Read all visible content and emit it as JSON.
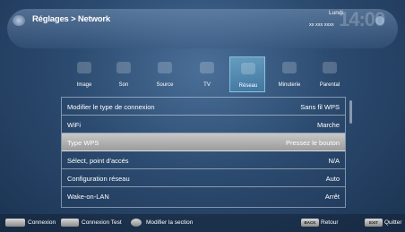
{
  "header": {
    "breadcrumb": "Réglages > Network",
    "day": "Lundi",
    "date": "xx xxx xxxx",
    "clock": "14:00"
  },
  "tabs": [
    {
      "label": "Image",
      "icon": "image-icon",
      "active": false
    },
    {
      "label": "Son",
      "icon": "sound-icon",
      "active": false
    },
    {
      "label": "Source",
      "icon": "source-icon",
      "active": false
    },
    {
      "label": "TV",
      "icon": "tv-icon",
      "active": false
    },
    {
      "label": "Réseau",
      "icon": "network-icon",
      "active": true
    },
    {
      "label": "Minuterie",
      "icon": "timer-icon",
      "active": false
    },
    {
      "label": "Parental",
      "icon": "parental-icon",
      "active": false
    }
  ],
  "rows": [
    {
      "label": "Modifier le type de connexion",
      "value": "Sans fil WPS",
      "selected": false
    },
    {
      "label": "WiFi",
      "value": "Marche",
      "selected": false
    },
    {
      "label": "Type WPS",
      "value": "Pressez le bouton",
      "selected": true
    },
    {
      "label": "Sélect, point d'accés",
      "value": "N/A",
      "selected": false
    },
    {
      "label": "Configuration réseau",
      "value": "Auto",
      "selected": false
    },
    {
      "label": "Wake-on-LAN",
      "value": "Arrêt",
      "selected": false
    }
  ],
  "footer": {
    "connexion": "Connexion",
    "connexion_test": "Connexion Test",
    "modify": "Modifier la section",
    "back_key": "BACK",
    "back": "Retour",
    "exit_key": "EXIT",
    "quit": "Quitter"
  },
  "colors": {
    "selected_row": "#b5b5b5",
    "active_tab": "#6fb6da"
  }
}
